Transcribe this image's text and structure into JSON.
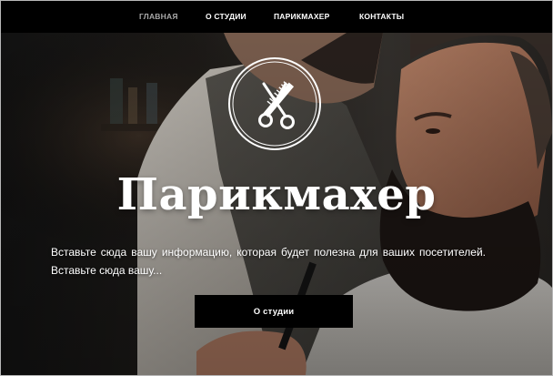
{
  "nav": {
    "items": [
      {
        "label": "ГЛАВНАЯ",
        "active": true
      },
      {
        "label": "О СТУДИИ",
        "active": false
      },
      {
        "label": "ПАРИКМАХЕР",
        "active": false
      },
      {
        "label": "КОНТАКТЫ",
        "active": false
      }
    ]
  },
  "hero": {
    "logo_icon": "scissors-comb-icon",
    "title": "Парикмахер",
    "text": "Вставьте сюда вашу информацию, которая будет полезна для ваших посетителей. Вставьте сюда вашу...",
    "button_label": "О студии"
  },
  "colors": {
    "nav_background": "#000000",
    "nav_active_text": "#a8a8a8",
    "nav_text": "#ffffff",
    "button_background": "#000000",
    "hero_text": "#ffffff"
  }
}
